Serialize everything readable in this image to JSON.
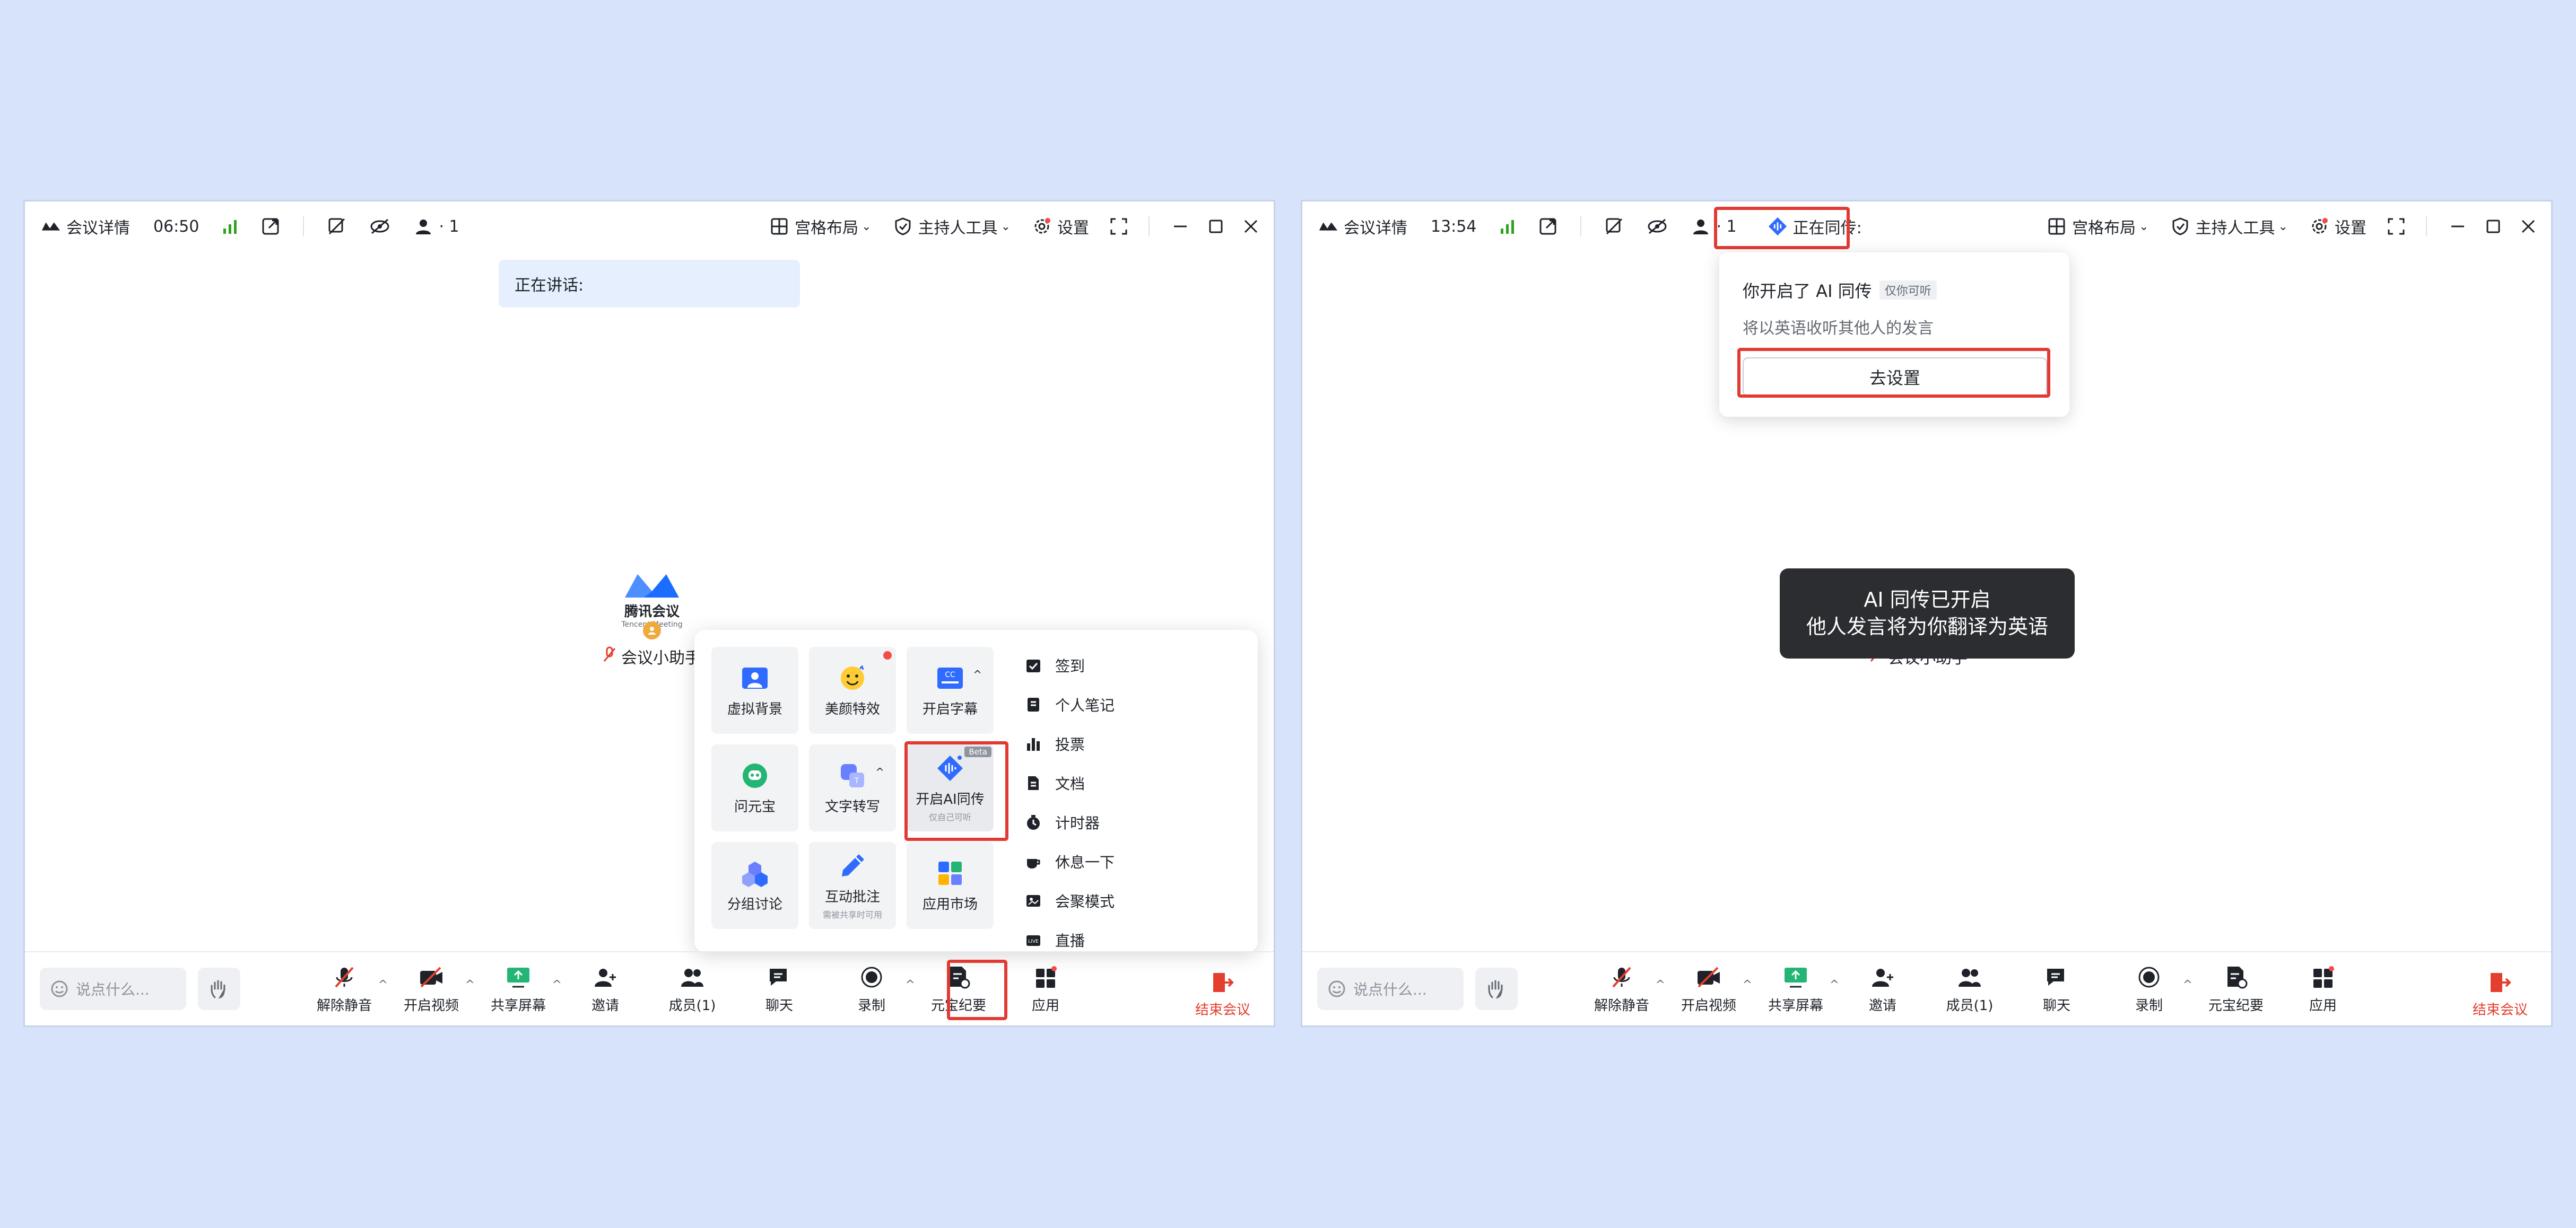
{
  "left_window": {
    "titlebar": {
      "meeting_info": "会议详情",
      "time": "06:50",
      "participant_count": "· 1",
      "layout_label": "宫格布局",
      "host_tools_label": "主持人工具",
      "settings_label": "设置"
    },
    "speaking_label": "正在讲话:",
    "avatar": {
      "logo_name": "腾讯会议",
      "logo_sub": "Tencent Meeting",
      "label": "会议小助手"
    },
    "apps_popup": {
      "tiles": [
        {
          "label": "虚拟背景"
        },
        {
          "label": "美颜特效"
        },
        {
          "label": "开启字幕"
        },
        {
          "label": "问元宝"
        },
        {
          "label": "文字转写"
        },
        {
          "label": "开启AI同传",
          "sub": "仅自己可听",
          "badge": "Beta"
        },
        {
          "label": "分组讨论"
        },
        {
          "label": "互动批注",
          "sub": "需被共享时可用"
        },
        {
          "label": "应用市场"
        }
      ],
      "list": [
        "签到",
        "个人笔记",
        "投票",
        "文档",
        "计时器",
        "休息一下",
        "会聚模式",
        "直播"
      ]
    },
    "bottombar": {
      "say_placeholder": "说点什么...",
      "tools": [
        "解除静音",
        "开启视频",
        "共享屏幕",
        "邀请",
        "成员(1)",
        "聊天",
        "录制",
        "元宝纪要",
        "应用"
      ],
      "end_label": "结束会议"
    }
  },
  "right_window": {
    "titlebar": {
      "meeting_info": "会议详情",
      "time": "13:54",
      "participant_count": "· 1",
      "ai_status": "正在同传:",
      "layout_label": "宫格布局",
      "host_tools_label": "主持人工具",
      "settings_label": "设置"
    },
    "popover": {
      "title": "你开启了 AI 同传",
      "tag": "仅你可听",
      "desc": "将以英语收听其他人的发言",
      "button": "去设置"
    },
    "toast": {
      "line1": "AI 同传已开启",
      "line2": "他人发言将为你翻译为英语"
    },
    "avatar_label": "会议小助手",
    "bottombar": {
      "say_placeholder": "说点什么...",
      "tools": [
        "解除静音",
        "开启视频",
        "共享屏幕",
        "邀请",
        "成员(1)",
        "聊天",
        "录制",
        "元宝纪要",
        "应用"
      ],
      "end_label": "结束会议"
    }
  },
  "colors": {
    "background": "#d6e3fb",
    "highlight_red": "#e23a32",
    "signal_green": "#2ea121",
    "end_red": "#e33e2e",
    "brand_blue": "#1a6dff"
  }
}
